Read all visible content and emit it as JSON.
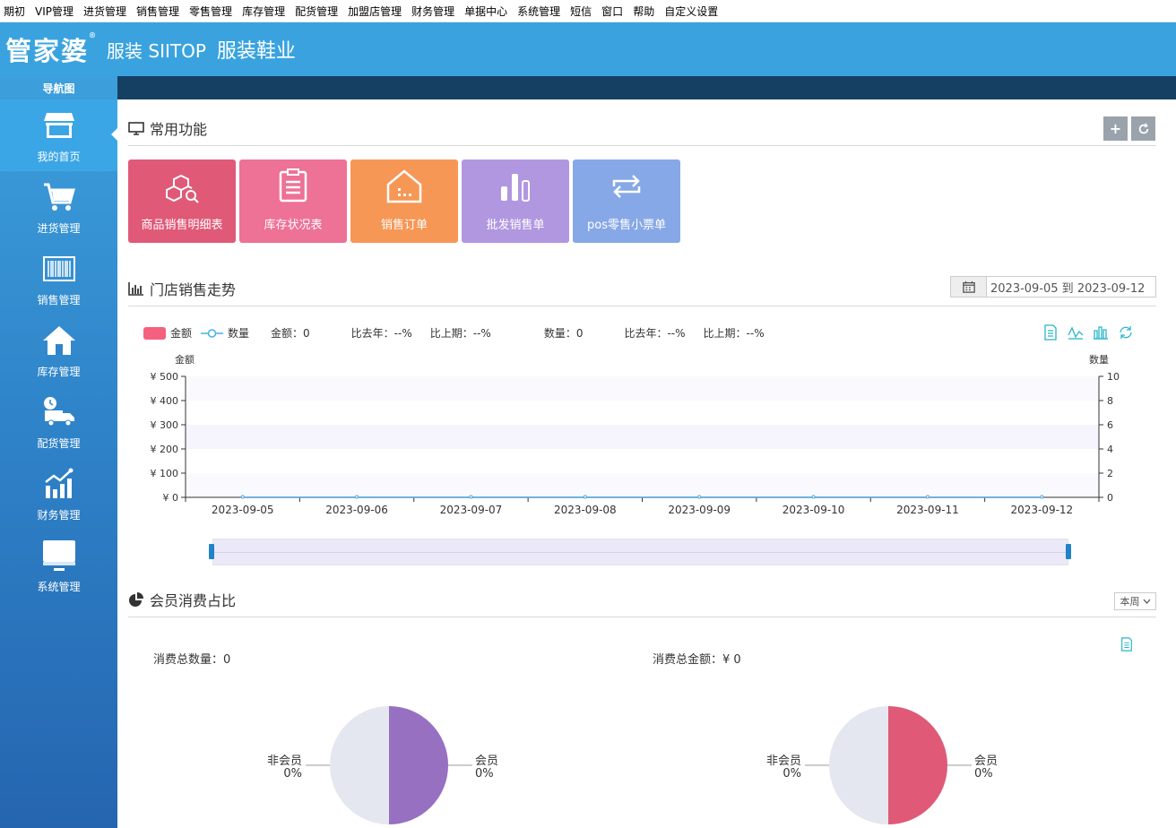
{
  "menu": [
    "期初",
    "VIP管理",
    "进货管理",
    "销售管理",
    "零售管理",
    "库存管理",
    "配货管理",
    "加盟店管理",
    "财务管理",
    "单据中心",
    "系统管理",
    "短信",
    "窗口",
    "帮助",
    "自定义设置"
  ],
  "header": {
    "logo": "管家婆",
    "sub": "服装 SIITOP",
    "sub2": "服装鞋业"
  },
  "sidebar": {
    "title": "导航图",
    "items": [
      {
        "label": "我的首页",
        "icon": "store-icon"
      },
      {
        "label": "进货管理",
        "icon": "cart-icon"
      },
      {
        "label": "销售管理",
        "icon": "barcode-icon"
      },
      {
        "label": "库存管理",
        "icon": "house-icon"
      },
      {
        "label": "配货管理",
        "icon": "truck-icon"
      },
      {
        "label": "财务管理",
        "icon": "growth-chart-icon"
      },
      {
        "label": "系统管理",
        "icon": "monitor-icon"
      }
    ]
  },
  "common": {
    "title": "常用功能",
    "tiles": [
      {
        "label": "商品销售明细表",
        "color": "#e05a78",
        "icon": "boxes-search-icon"
      },
      {
        "label": "库存状况表",
        "color": "#ee7196",
        "icon": "clipboard-icon"
      },
      {
        "label": "销售订单",
        "color": "#f79755",
        "icon": "warehouse-icon"
      },
      {
        "label": "批发销售单",
        "color": "#b197e0",
        "icon": "bar-chart-icon"
      },
      {
        "label": "pos零售小票单",
        "color": "#86a8e6",
        "icon": "repeat-icon"
      }
    ]
  },
  "trend": {
    "title": "门店销售走势",
    "date_range": "2023-09-05 到 2023-09-12",
    "legend_amount": "金额",
    "legend_qty": "数量",
    "stat_amount": "金额：0",
    "stat_yoy1": "比去年：--%",
    "stat_mom1": "比上期：--%",
    "stat_qty": "数量：0",
    "stat_yoy2": "比去年：--%",
    "stat_mom2": "比上期：--%"
  },
  "chart_data": {
    "type": "line",
    "title": "",
    "xlabel": "",
    "ylabel": "金额",
    "ylabel_right": "数量",
    "categories": [
      "2023-09-05",
      "2023-09-06",
      "2023-09-07",
      "2023-09-08",
      "2023-09-09",
      "2023-09-10",
      "2023-09-11",
      "2023-09-12"
    ],
    "y_ticks": [
      "¥ 0",
      "¥ 100",
      "¥ 200",
      "¥ 300",
      "¥ 400",
      "¥ 500"
    ],
    "y2_ticks": [
      "0",
      "2",
      "4",
      "6",
      "8",
      "10"
    ],
    "ylim": [
      0,
      500
    ],
    "y2lim": [
      0,
      10
    ],
    "series": [
      {
        "name": "金额",
        "axis": "left",
        "values": [
          0,
          0,
          0,
          0,
          0,
          0,
          0,
          0
        ],
        "color": "#f5607e"
      },
      {
        "name": "数量",
        "axis": "right",
        "values": [
          0,
          0,
          0,
          0,
          0,
          0,
          0,
          0
        ],
        "color": "#4bb1e6"
      }
    ]
  },
  "member": {
    "title": "会员消费占比",
    "period": "本周",
    "total_qty": "消费总数量：0",
    "total_amt": "消费总金额：¥ 0",
    "pie_left": {
      "member": "会员",
      "member_pct": "0%",
      "non_member": "非会员",
      "non_member_pct": "0%",
      "color": "#9770c2"
    },
    "pie_right": {
      "member": "会员",
      "member_pct": "0%",
      "non_member": "非会员",
      "non_member_pct": "0%",
      "color": "#e05a78"
    }
  }
}
